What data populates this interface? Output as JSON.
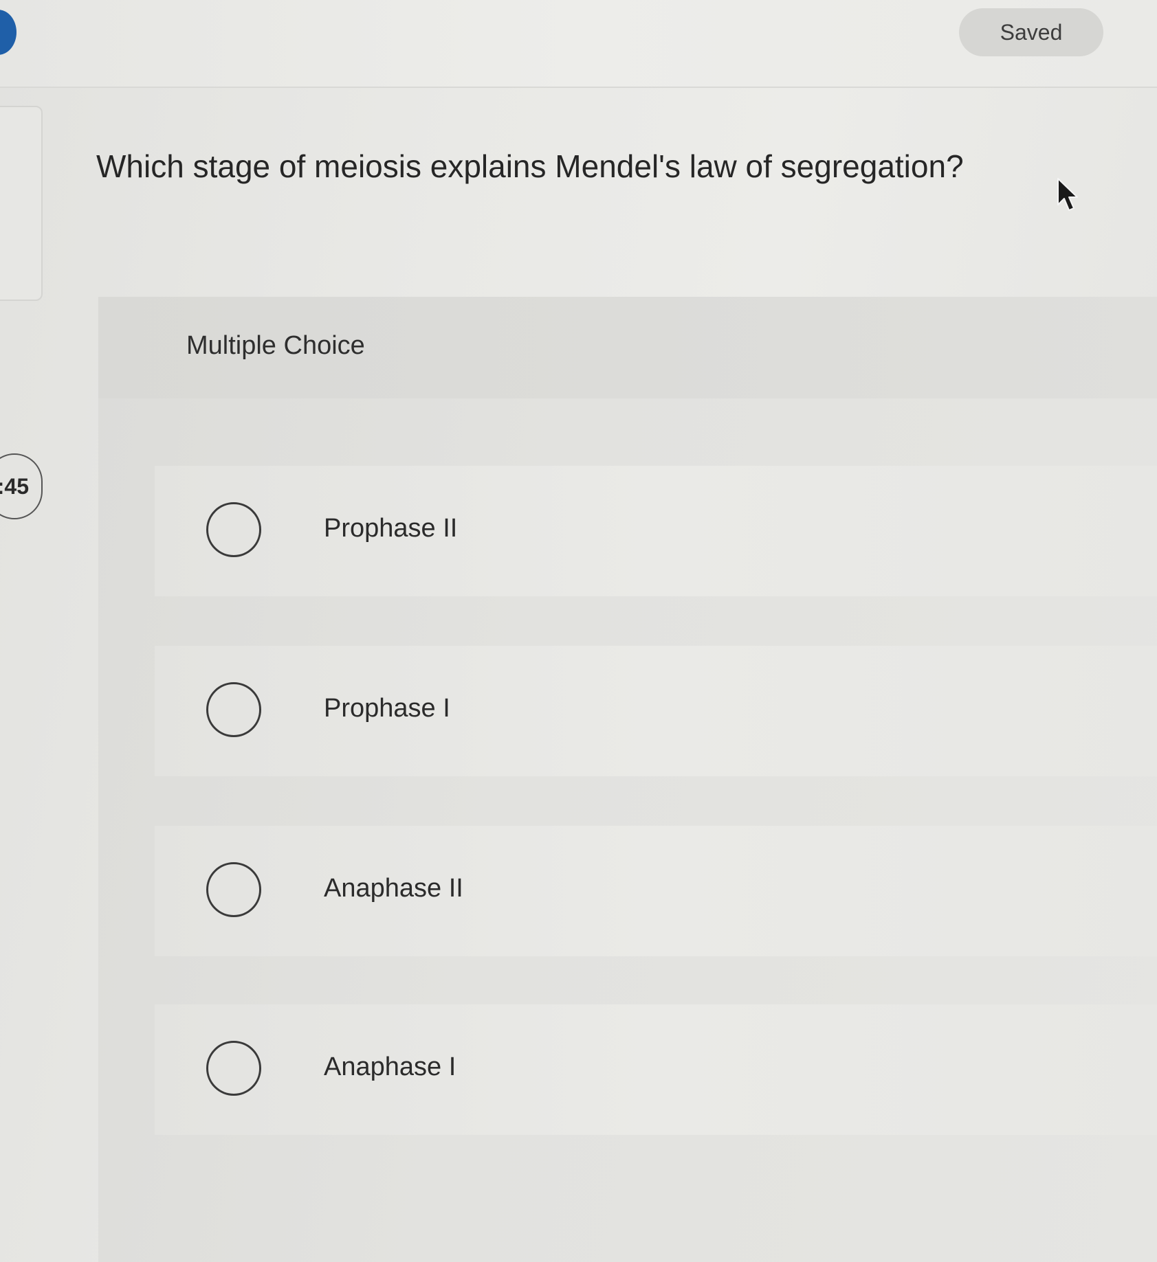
{
  "header": {
    "save_status": "Saved"
  },
  "question": {
    "text": "Which stage of meiosis explains Mendel's law of segregation?"
  },
  "question_type": {
    "label": "Multiple Choice"
  },
  "timer": {
    "value": ":45"
  },
  "options": [
    {
      "label": "Prophase II"
    },
    {
      "label": "Prophase I"
    },
    {
      "label": "Anaphase II"
    },
    {
      "label": "Anaphase I"
    }
  ],
  "colors": {
    "accent": "#1f5fa8",
    "pill_background": "#d6d6d3",
    "text": "#2b2b2b"
  },
  "icons": {
    "radio": "radio-unchecked-icon",
    "cursor": "mouse-pointer-icon"
  }
}
